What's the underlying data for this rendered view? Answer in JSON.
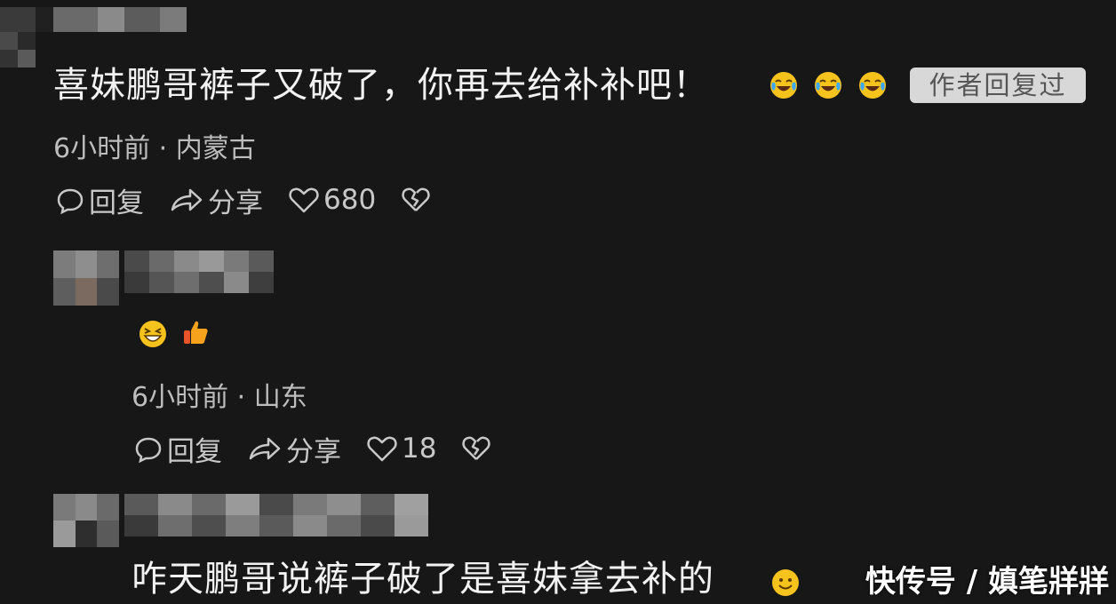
{
  "comments": [
    {
      "text": "喜妹鹏哥裤子又破了，你再去给补补吧！",
      "emojis": [
        "crying-laughing-icon",
        "crying-laughing-icon",
        "crying-laughing-icon"
      ],
      "badge": "作者回复过",
      "meta": "6小时前 · 内蒙古",
      "reply_label": "回复",
      "share_label": "分享",
      "likes": "680"
    },
    {
      "text": "",
      "emojis": [
        "grinning-squint-icon",
        "thumbs-up-icon"
      ],
      "meta": "6小时前 · 山东",
      "reply_label": "回复",
      "share_label": "分享",
      "likes": "18"
    },
    {
      "text": "咋天鹏哥说裤子破了是喜妹拿去补的",
      "emojis": [
        "smiling-face-icon"
      ]
    }
  ],
  "watermark": "快传号 / 嫃笔牂牂",
  "colors": {
    "background": "#171717",
    "text": "#f2f2f2",
    "meta": "#bdbdbd",
    "badge_bg": "#d8d8d8",
    "emoji_yellow": "#f6c21c"
  }
}
